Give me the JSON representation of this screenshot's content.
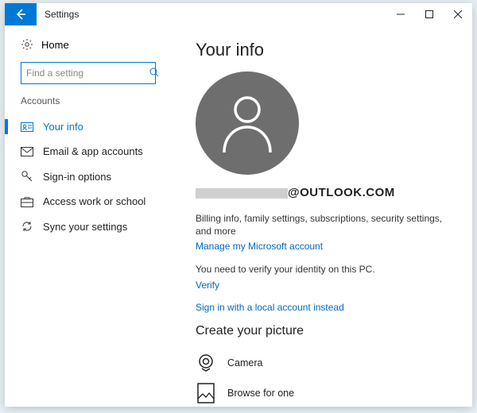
{
  "titlebar": {
    "title": "Settings"
  },
  "sidebar": {
    "home": "Home",
    "search_placeholder": "Find a setting",
    "section": "Accounts",
    "items": [
      {
        "label": "Your info"
      },
      {
        "label": "Email & app accounts"
      },
      {
        "label": "Sign-in options"
      },
      {
        "label": "Access work or school"
      },
      {
        "label": "Sync your settings"
      }
    ]
  },
  "main": {
    "title": "Your info",
    "email_suffix": "@OUTLOOK.COM",
    "billing_desc": "Billing info, family settings, subscriptions, security settings, and more",
    "manage_link": "Manage my Microsoft account",
    "verify_desc": "You need to verify your identity on this PC.",
    "verify_link": "Verify",
    "local_link": "Sign in with a local account instead",
    "picture_heading": "Create your picture",
    "camera": "Camera",
    "browse": "Browse for one"
  }
}
